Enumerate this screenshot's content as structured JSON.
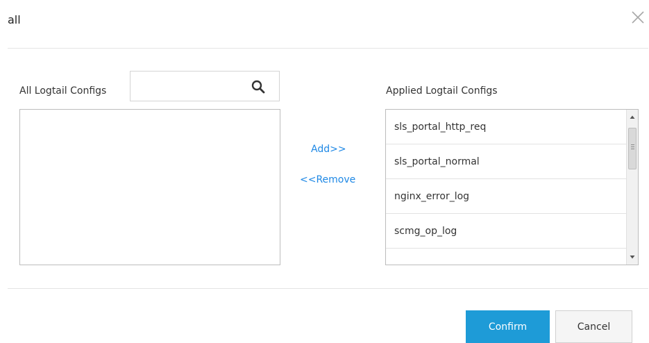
{
  "dialog": {
    "title": "all"
  },
  "left_panel": {
    "label": "All Logtail Configs",
    "search_value": "",
    "items": []
  },
  "transfer": {
    "add_label": "Add>>",
    "remove_label": "<<Remove"
  },
  "right_panel": {
    "label": "Applied Logtail Configs",
    "items": [
      "sls_portal_http_req",
      "sls_portal_normal",
      "nginx_error_log",
      "scmg_op_log"
    ]
  },
  "footer": {
    "confirm_label": "Confirm",
    "cancel_label": "Cancel"
  },
  "colors": {
    "accent": "#1e9bd7",
    "link": "#1e88e5"
  }
}
